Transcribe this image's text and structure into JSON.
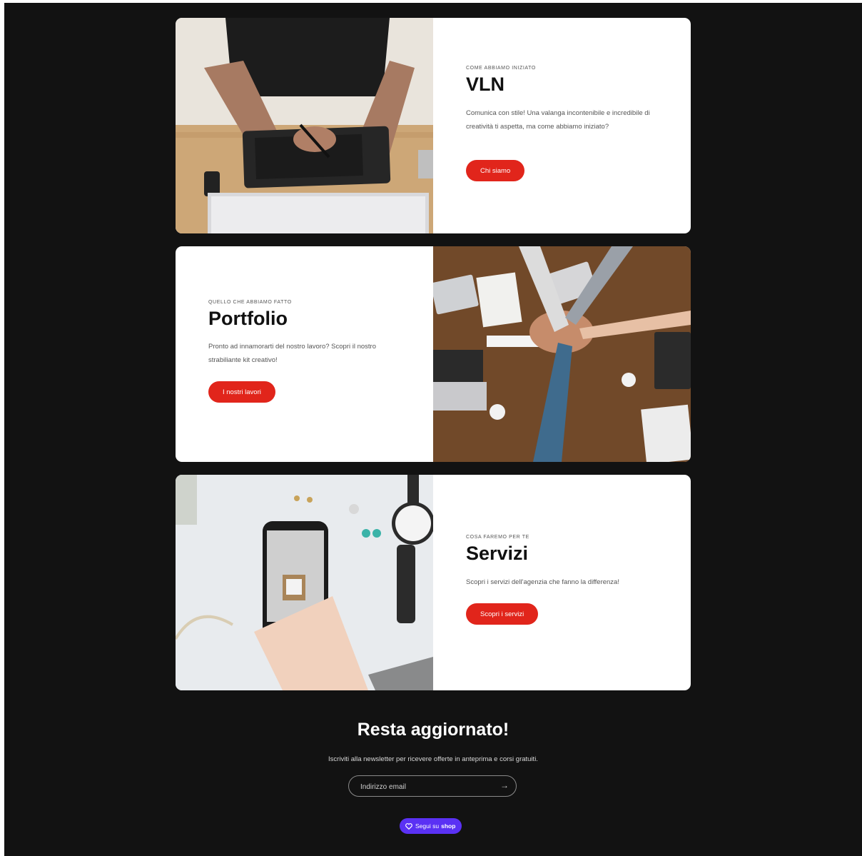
{
  "cards": [
    {
      "eyebrow": "COME ABBIAMO INIZIATO",
      "title": "VLN",
      "description": "Comunica con stile! Una valanga incontenibile e incredibile di creatività ti aspetta, ma come abbiamo iniziato?",
      "button_label": "Chi siamo"
    },
    {
      "eyebrow": "QUELLO CHE ABBIAMO FATTO",
      "title": "Portfolio",
      "description": "Pronto ad innamorarti del nostro lavoro? Scopri il nostro strabiliante kit creativo!",
      "button_label": "I nostri lavori"
    },
    {
      "eyebrow": "COSA FAREMO PER TE",
      "title": "Servizi",
      "description": "Scopri i servizi dell'agenzia che fanno la differenza!",
      "button_label": "Scopri i servizi"
    }
  ],
  "newsletter": {
    "title": "Resta aggiornato!",
    "subtitle": "Iscriviti alla newsletter per ricevere offerte in anteprima e corsi gratuiti.",
    "email_placeholder": "Indirizzo email"
  },
  "shop_button": {
    "label": "Segui su",
    "brand": "shop"
  },
  "colors": {
    "background": "#121212",
    "accent": "#e1251b",
    "shop": "#5a31f4"
  },
  "icons": {
    "submit": "arrow-right-icon",
    "shop": "heart-icon"
  }
}
